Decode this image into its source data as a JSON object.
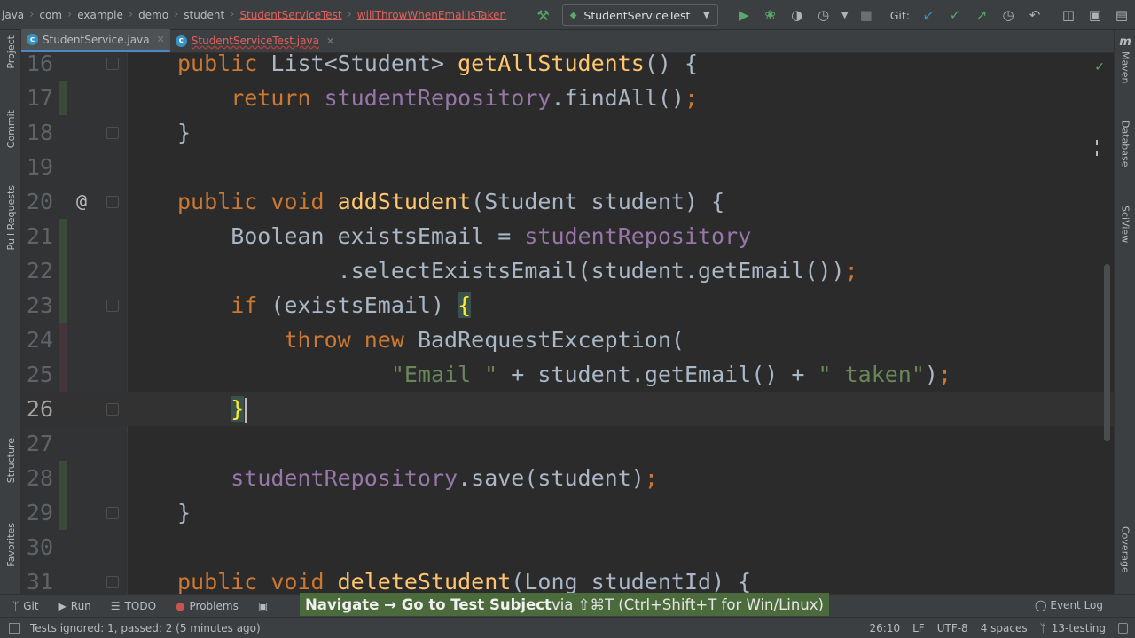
{
  "breadcrumbs": [
    "java",
    "com",
    "example",
    "demo",
    "student",
    "StudentServiceTest",
    "willThrowWhenEmailIsTaken"
  ],
  "run_config": {
    "label": "StudentServiceTest"
  },
  "git_label": "Git:",
  "tabs": [
    {
      "label": "StudentService.java",
      "icon_letter": "c",
      "active": true,
      "has_error": false
    },
    {
      "label": "StudentServiceTest.java",
      "icon_letter": "c",
      "active": false,
      "has_error": true
    }
  ],
  "left_tools": [
    "Project",
    "Commit",
    "Pull Requests",
    "Structure",
    "Favorites"
  ],
  "right_tools": [
    "Maven",
    "Database",
    "SciView",
    "Coverage"
  ],
  "editor": {
    "caret_line": 26,
    "lines": [
      {
        "num": "16",
        "vcs": "none",
        "tokens": [
          {
            "t": "public ",
            "c": "kw"
          },
          {
            "t": "List<Student> ",
            "c": "p"
          },
          {
            "t": "getAllStudents",
            "c": "mth"
          },
          {
            "t": "() {",
            "c": "p"
          }
        ]
      },
      {
        "num": "17",
        "vcs": "add",
        "tokens": [
          {
            "t": "    return ",
            "c": "kw"
          },
          {
            "t": "studentRepository",
            "c": "fld"
          },
          {
            "t": ".findAll()",
            "c": "p"
          },
          {
            "t": ";",
            "c": "kw"
          }
        ]
      },
      {
        "num": "18",
        "vcs": "none",
        "tokens": [
          {
            "t": "}",
            "c": "p"
          }
        ]
      },
      {
        "num": "19",
        "vcs": "none",
        "tokens": []
      },
      {
        "num": "20",
        "vcs": "none",
        "annot": "@",
        "tokens": [
          {
            "t": "public void ",
            "c": "kw"
          },
          {
            "t": "addStudent",
            "c": "mth"
          },
          {
            "t": "(Student student) {",
            "c": "p"
          }
        ]
      },
      {
        "num": "21",
        "vcs": "add",
        "tokens": [
          {
            "t": "    Boolean existsEmail = ",
            "c": "p"
          },
          {
            "t": "studentRepository",
            "c": "fld"
          }
        ]
      },
      {
        "num": "22",
        "vcs": "add",
        "tokens": [
          {
            "t": "            .selectExistsEmail(student.getEmail())",
            "c": "p"
          },
          {
            "t": ";",
            "c": "kw"
          }
        ]
      },
      {
        "num": "23",
        "vcs": "add",
        "tokens": [
          {
            "t": "    if ",
            "c": "kw"
          },
          {
            "t": "(existsEmail) ",
            "c": "p"
          },
          {
            "t": "{",
            "c": "hl"
          }
        ]
      },
      {
        "num": "24",
        "vcs": "mod",
        "tokens": [
          {
            "t": "        throw new ",
            "c": "kw"
          },
          {
            "t": "BadRequestException(",
            "c": "p"
          }
        ]
      },
      {
        "num": "25",
        "vcs": "mod",
        "tokens": [
          {
            "t": "                ",
            "c": "p"
          },
          {
            "t": "\"Email \"",
            "c": "str"
          },
          {
            "t": " + student.getEmail() + ",
            "c": "p"
          },
          {
            "t": "\" taken\"",
            "c": "str"
          },
          {
            "t": ")",
            "c": "p"
          },
          {
            "t": ";",
            "c": "kw"
          }
        ]
      },
      {
        "num": "26",
        "vcs": "none",
        "tokens": [
          {
            "t": "    ",
            "c": "p"
          },
          {
            "t": "}",
            "c": "hl"
          }
        ]
      },
      {
        "num": "27",
        "vcs": "none",
        "tokens": []
      },
      {
        "num": "28",
        "vcs": "add",
        "tokens": [
          {
            "t": "    ",
            "c": "p"
          },
          {
            "t": "studentRepository",
            "c": "fld"
          },
          {
            "t": ".save(student)",
            "c": "p"
          },
          {
            "t": ";",
            "c": "kw"
          }
        ]
      },
      {
        "num": "29",
        "vcs": "add",
        "tokens": [
          {
            "t": "}",
            "c": "p"
          }
        ]
      },
      {
        "num": "30",
        "vcs": "none",
        "tokens": []
      },
      {
        "num": "31",
        "vcs": "none",
        "tokens": [
          {
            "t": "public void ",
            "c": "kw"
          },
          {
            "t": "deleteStudent",
            "c": "mth"
          },
          {
            "t": "(Long studentId) {",
            "c": "p"
          }
        ]
      }
    ]
  },
  "bottom_tools": [
    {
      "label": "Git",
      "icon": "git-branch-icon"
    },
    {
      "label": "Run",
      "icon": "run-icon"
    },
    {
      "label": "TODO",
      "icon": "todo-list-icon"
    },
    {
      "label": "Problems",
      "icon": "problems-icon"
    }
  ],
  "tooltip": {
    "prefix": "Navigate → Go to Test Subject",
    "suffix": " via ⇧⌘T (Ctrl+Shift+T for Win/Linux)"
  },
  "event_log": "Event Log",
  "status": {
    "message": "Tests ignored: 1, passed: 2 (5 minutes ago)",
    "position": "26:10",
    "line_sep": "LF",
    "encoding": "UTF-8",
    "indent": "4 spaces",
    "branch": "13-testing"
  },
  "colors": {
    "keyword": "#cc7832",
    "field": "#9876aa",
    "method": "#ffc66d",
    "string": "#6a8759",
    "accent": "#4a88c7",
    "run_green": "#59a869",
    "error_red": "#e0605b"
  }
}
